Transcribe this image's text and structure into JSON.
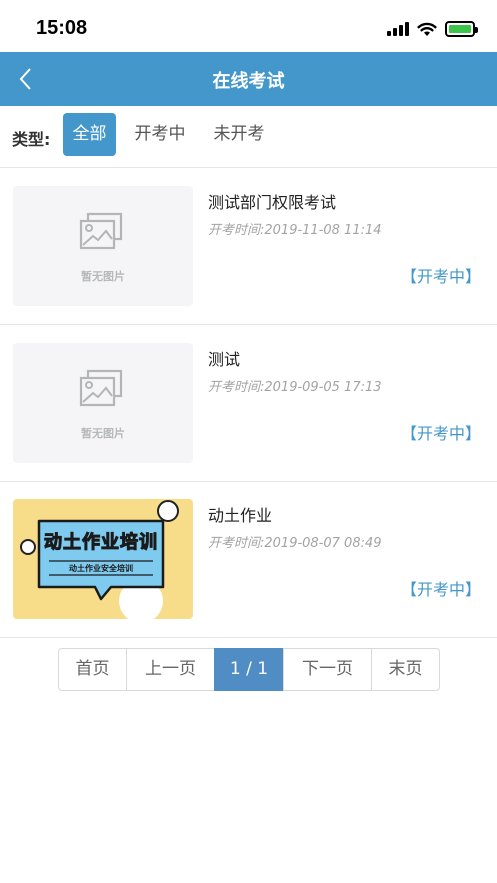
{
  "status_bar": {
    "time": "15:08"
  },
  "nav": {
    "title": "在线考试"
  },
  "filter": {
    "label": "类型:",
    "tabs": [
      {
        "label": "全部",
        "active": true
      },
      {
        "label": "开考中",
        "active": false
      },
      {
        "label": "未开考",
        "active": false
      }
    ]
  },
  "exams": [
    {
      "title": "测试部门权限考试",
      "time": "开考时间:2019-11-08 11:14",
      "status": "【开考中】",
      "image": "placeholder",
      "placeholder_text": "暂无图片"
    },
    {
      "title": "测试",
      "time": "开考时间:2019-09-05 17:13",
      "status": "【开考中】",
      "image": "placeholder",
      "placeholder_text": "暂无图片"
    },
    {
      "title": "动土作业",
      "time": "开考时间:2019-08-07 08:49",
      "status": "【开考中】",
      "image": "cover",
      "cover_title": "动土作业培训",
      "cover_subtitle": "动土作业安全培训"
    }
  ],
  "pagination": {
    "first": "首页",
    "prev": "上一页",
    "current": "1 / 1",
    "next": "下一页",
    "last": "末页"
  },
  "colors": {
    "primary": "#4397cb",
    "battery": "#3dc54b",
    "cover_bg": "#f7dd8a",
    "cover_banner": "#7fcbef"
  }
}
